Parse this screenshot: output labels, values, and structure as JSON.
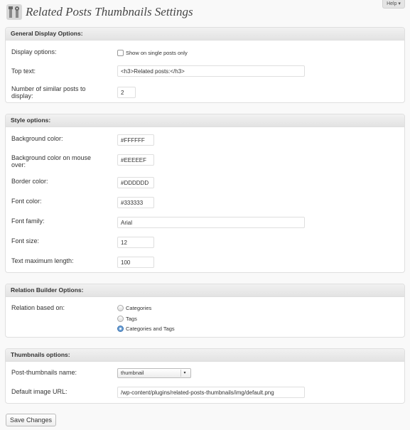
{
  "header": {
    "title": "Related Posts Thumbnails Settings",
    "help_label": "Help ▾"
  },
  "general": {
    "title": "General Display Options:",
    "display_options_label": "Display options:",
    "show_single_label": "Show on single posts only",
    "top_text_label": "Top text:",
    "top_text_value": "<h3>Related posts:</h3>",
    "num_posts_label": "Number of similar posts to display:",
    "num_posts_value": "2"
  },
  "style": {
    "title": "Style options:",
    "bg_color_label": "Background color:",
    "bg_color_value": "#FFFFFF",
    "bg_hover_label": "Background color on mouse over:",
    "bg_hover_value": "#EEEEEF",
    "border_color_label": "Border color:",
    "border_color_value": "#DDDDDD",
    "font_color_label": "Font color:",
    "font_color_value": "#333333",
    "font_family_label": "Font family:",
    "font_family_value": "Arial",
    "font_size_label": "Font size:",
    "font_size_value": "12",
    "text_max_label": "Text maximum length:",
    "text_max_value": "100"
  },
  "relation": {
    "title": "Relation Builder Options:",
    "label": "Relation based on:",
    "options": [
      "Categories",
      "Tags",
      "Categories and Tags"
    ],
    "selected": "Categories and Tags"
  },
  "thumbs": {
    "title": "Thumbnails options:",
    "name_label": "Post-thumbnails name:",
    "name_value": "thumbnail",
    "default_url_label": "Default image URL:",
    "default_url_value": "/wp-content/plugins/related-posts-thumbnails/img/default.png"
  },
  "actions": {
    "save_label": "Save Changes"
  }
}
